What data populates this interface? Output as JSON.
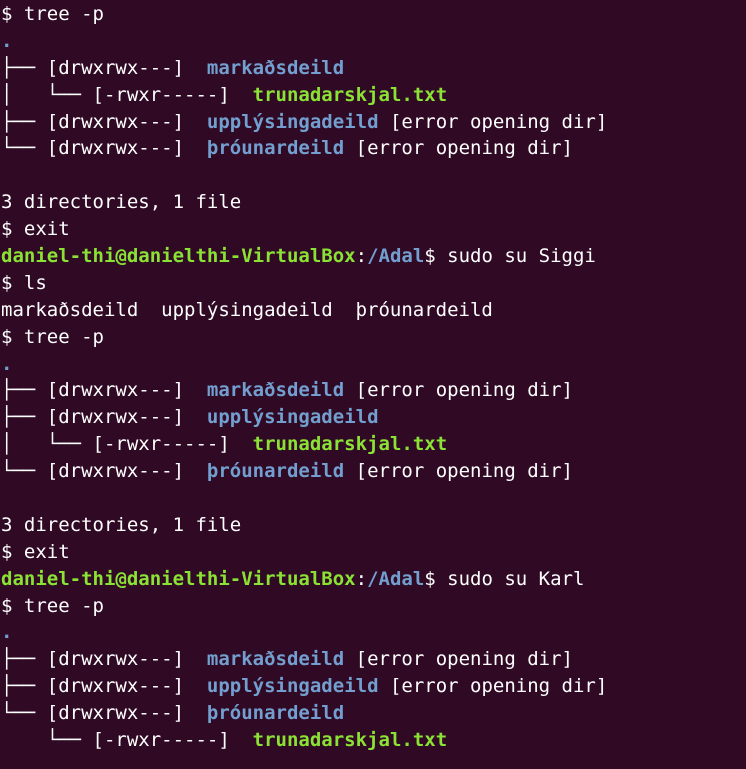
{
  "colors": {
    "background": "#300a24",
    "text": "#ffffff",
    "directory": "#729fcf",
    "file": "#8ae234",
    "user_host": "#8ae234",
    "path": "#729fcf"
  },
  "lines": [
    {
      "type": "cmd",
      "prompt": "$ ",
      "cmd": "tree -p"
    },
    {
      "type": "dot",
      "text": "."
    },
    {
      "type": "tree",
      "prefix": "├── ",
      "perm": "[drwxrwx---]  ",
      "name": "markaðsdeild",
      "kind": "dir",
      "suffix": ""
    },
    {
      "type": "tree",
      "prefix": "│   └── ",
      "perm": "[-rwxr-----]  ",
      "name": "trunadarskjal.txt",
      "kind": "file",
      "suffix": ""
    },
    {
      "type": "tree",
      "prefix": "├── ",
      "perm": "[drwxrwx---]  ",
      "name": "upplýsingadeild",
      "kind": "dir",
      "suffix": " [error opening dir]"
    },
    {
      "type": "tree",
      "prefix": "└── ",
      "perm": "[drwxrwx---]  ",
      "name": "þróunardeild",
      "kind": "dir",
      "suffix": " [error opening dir]"
    },
    {
      "type": "plain",
      "text": ""
    },
    {
      "type": "plain",
      "text": "3 directories, 1 file"
    },
    {
      "type": "cmd",
      "prompt": "$ ",
      "cmd": "exit"
    },
    {
      "type": "shell",
      "userhost": "daniel-thi@danielthi-VirtualBox",
      "colon": ":",
      "path": "/Adal",
      "dollar": "$ ",
      "cmd": "sudo su Siggi"
    },
    {
      "type": "cmd",
      "prompt": "$ ",
      "cmd": "ls"
    },
    {
      "type": "plain",
      "text": "markaðsdeild  upplýsingadeild  þróunardeild"
    },
    {
      "type": "cmd",
      "prompt": "$ ",
      "cmd": "tree -p"
    },
    {
      "type": "dot",
      "text": "."
    },
    {
      "type": "tree",
      "prefix": "├── ",
      "perm": "[drwxrwx---]  ",
      "name": "markaðsdeild",
      "kind": "dir",
      "suffix": " [error opening dir]"
    },
    {
      "type": "tree",
      "prefix": "├── ",
      "perm": "[drwxrwx---]  ",
      "name": "upplýsingadeild",
      "kind": "dir",
      "suffix": ""
    },
    {
      "type": "tree",
      "prefix": "│   └── ",
      "perm": "[-rwxr-----]  ",
      "name": "trunadarskjal.txt",
      "kind": "file",
      "suffix": ""
    },
    {
      "type": "tree",
      "prefix": "└── ",
      "perm": "[drwxrwx---]  ",
      "name": "þróunardeild",
      "kind": "dir",
      "suffix": " [error opening dir]"
    },
    {
      "type": "plain",
      "text": ""
    },
    {
      "type": "plain",
      "text": "3 directories, 1 file"
    },
    {
      "type": "cmd",
      "prompt": "$ ",
      "cmd": "exit"
    },
    {
      "type": "shell",
      "userhost": "daniel-thi@danielthi-VirtualBox",
      "colon": ":",
      "path": "/Adal",
      "dollar": "$ ",
      "cmd": "sudo su Karl"
    },
    {
      "type": "cmd",
      "prompt": "$ ",
      "cmd": "tree -p"
    },
    {
      "type": "dot",
      "text": "."
    },
    {
      "type": "tree",
      "prefix": "├── ",
      "perm": "[drwxrwx---]  ",
      "name": "markaðsdeild",
      "kind": "dir",
      "suffix": " [error opening dir]"
    },
    {
      "type": "tree",
      "prefix": "├── ",
      "perm": "[drwxrwx---]  ",
      "name": "upplýsingadeild",
      "kind": "dir",
      "suffix": " [error opening dir]"
    },
    {
      "type": "tree",
      "prefix": "└── ",
      "perm": "[drwxrwx---]  ",
      "name": "þróunardeild",
      "kind": "dir",
      "suffix": ""
    },
    {
      "type": "tree",
      "prefix": "    └── ",
      "perm": "[-rwxr-----]  ",
      "name": "trunadarskjal.txt",
      "kind": "file",
      "suffix": ""
    }
  ]
}
